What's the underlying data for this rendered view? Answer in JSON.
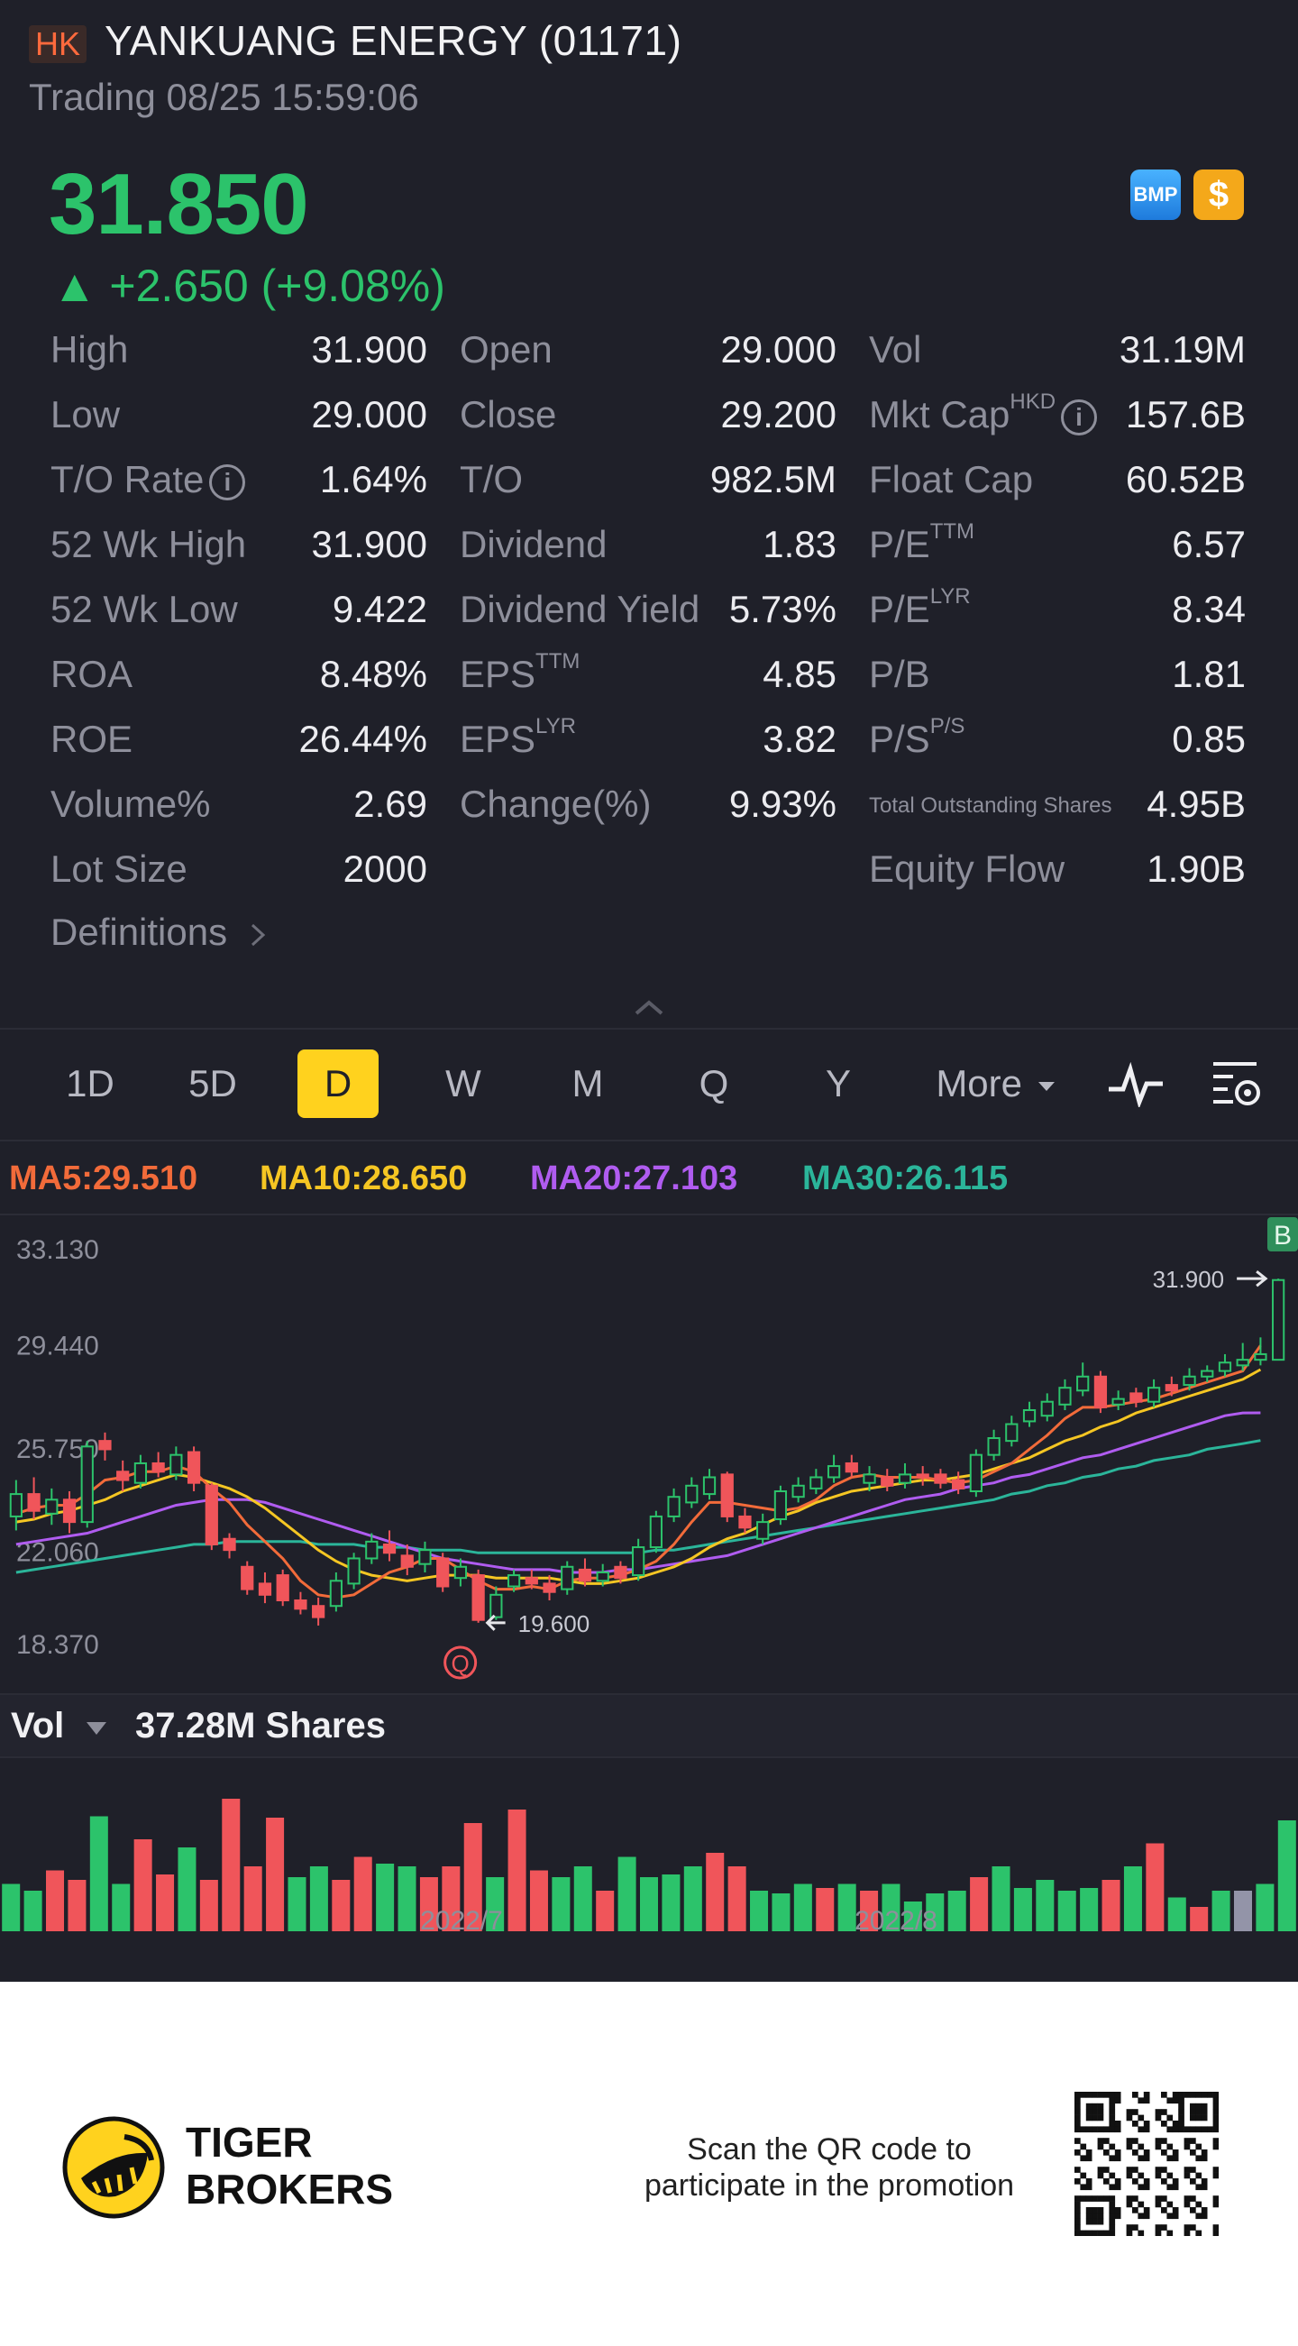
{
  "header": {
    "market": "HK",
    "title": "YANKUANG ENERGY (01171)",
    "status": "Trading 08/25 15:59:06"
  },
  "quote": {
    "price": "31.850",
    "change": "▲ +2.650 (+9.08%)",
    "bmp_label": "BMP",
    "dollar_label": "$",
    "up_color": "#2cc36b"
  },
  "stats": [
    [
      {
        "label": "High",
        "value": "31.900"
      },
      {
        "label": "Open",
        "value": "29.000"
      },
      {
        "label": "Vol",
        "value": "31.19M"
      }
    ],
    [
      {
        "label": "Low",
        "value": "29.000"
      },
      {
        "label": "Close",
        "value": "29.200"
      },
      {
        "label": "Mkt Cap",
        "sup": "HKD",
        "info": true,
        "value": "157.6B"
      }
    ],
    [
      {
        "label": "T/O Rate",
        "info": true,
        "value": "1.64%"
      },
      {
        "label": "T/O",
        "value": "982.5M"
      },
      {
        "label": "Float Cap",
        "value": "60.52B"
      }
    ],
    [
      {
        "label": "52 Wk High",
        "value": "31.900"
      },
      {
        "label": "Dividend",
        "value": "1.83"
      },
      {
        "label": "P/E",
        "sup": "TTM",
        "value": "6.57"
      }
    ],
    [
      {
        "label": "52 Wk Low",
        "value": "9.422"
      },
      {
        "label": "Dividend Yield",
        "value": "5.73%"
      },
      {
        "label": "P/E",
        "sup": "LYR",
        "value": "8.34"
      }
    ],
    [
      {
        "label": "ROA",
        "value": "8.48%"
      },
      {
        "label": "EPS",
        "sup": "TTM",
        "value": "4.85"
      },
      {
        "label": "P/B",
        "value": "1.81"
      }
    ],
    [
      {
        "label": "ROE",
        "value": "26.44%"
      },
      {
        "label": "EPS",
        "sup": "LYR",
        "value": "3.82"
      },
      {
        "label": "P/S",
        "sup": "P/S",
        "value": "0.85"
      }
    ],
    [
      {
        "label": "Volume%",
        "value": "2.69"
      },
      {
        "label": "Change(%)",
        "value": "9.93%"
      },
      {
        "label": "Total Outstanding Shares",
        "small": true,
        "value": "4.95B"
      }
    ],
    [
      {
        "label": "Lot Size",
        "value": "2000"
      },
      {
        "label": "",
        "value": ""
      },
      {
        "label": "Equity Flow",
        "value": "1.90B"
      }
    ]
  ],
  "definitions_label": "Definitions",
  "tabs": [
    "1D",
    "5D",
    "D",
    "W",
    "M",
    "Q",
    "Y",
    "More"
  ],
  "active_tab": "D",
  "ma": {
    "ma5": "MA5:29.510",
    "ma5_color": "#f26b3a",
    "ma10": "MA10:28.650",
    "ma10_color": "#f5c623",
    "ma20": "MA20:27.103",
    "ma20_color": "#b05cf0",
    "ma30": "MA30:26.115",
    "ma30_color": "#2bb59a"
  },
  "chart_data": {
    "type": "candlestick",
    "y_ticks": [
      "33.130",
      "29.440",
      "25.750",
      "22.060",
      "18.370"
    ],
    "ylim": [
      18.37,
      33.13
    ],
    "high_marker": "31.900",
    "low_marker": "19.600",
    "x_labels": [
      "2022/7",
      "2022/8"
    ],
    "event_marker": "Q",
    "buy_marker": "B",
    "candles": [
      {
        "o": 23.4,
        "c": 24.2,
        "h": 24.7,
        "l": 22.9
      },
      {
        "o": 24.2,
        "c": 23.6,
        "h": 24.8,
        "l": 23.3
      },
      {
        "o": 23.5,
        "c": 24.0,
        "h": 24.4,
        "l": 23.1
      },
      {
        "o": 24.0,
        "c": 23.2,
        "h": 24.3,
        "l": 22.8
      },
      {
        "o": 23.2,
        "c": 25.9,
        "h": 26.1,
        "l": 23.0
      },
      {
        "o": 26.1,
        "c": 25.8,
        "h": 26.4,
        "l": 25.4
      },
      {
        "o": 25.0,
        "c": 24.7,
        "h": 25.4,
        "l": 24.3
      },
      {
        "o": 24.6,
        "c": 25.3,
        "h": 25.6,
        "l": 24.4
      },
      {
        "o": 25.3,
        "c": 25.0,
        "h": 25.7,
        "l": 24.8
      },
      {
        "o": 24.9,
        "c": 25.6,
        "h": 25.9,
        "l": 24.7
      },
      {
        "o": 25.7,
        "c": 24.6,
        "h": 25.9,
        "l": 24.3
      },
      {
        "o": 24.5,
        "c": 22.4,
        "h": 24.6,
        "l": 22.2
      },
      {
        "o": 22.6,
        "c": 22.2,
        "h": 22.8,
        "l": 21.9
      },
      {
        "o": 21.6,
        "c": 20.8,
        "h": 21.8,
        "l": 20.6
      },
      {
        "o": 21.0,
        "c": 20.6,
        "h": 21.4,
        "l": 20.3
      },
      {
        "o": 21.3,
        "c": 20.4,
        "h": 21.5,
        "l": 20.2
      },
      {
        "o": 20.4,
        "c": 20.1,
        "h": 20.7,
        "l": 19.9
      },
      {
        "o": 20.2,
        "c": 19.8,
        "h": 20.5,
        "l": 19.5
      },
      {
        "o": 20.2,
        "c": 21.1,
        "h": 21.4,
        "l": 20.0
      },
      {
        "o": 21.0,
        "c": 21.9,
        "h": 22.1,
        "l": 20.8
      },
      {
        "o": 21.9,
        "c": 22.5,
        "h": 22.8,
        "l": 21.7
      },
      {
        "o": 22.4,
        "c": 22.1,
        "h": 22.9,
        "l": 21.8
      },
      {
        "o": 22.0,
        "c": 21.6,
        "h": 22.4,
        "l": 21.3
      },
      {
        "o": 21.7,
        "c": 22.2,
        "h": 22.5,
        "l": 21.4
      },
      {
        "o": 21.9,
        "c": 20.9,
        "h": 22.1,
        "l": 20.7
      },
      {
        "o": 21.2,
        "c": 21.6,
        "h": 21.9,
        "l": 20.9
      },
      {
        "o": 21.3,
        "c": 19.7,
        "h": 21.5,
        "l": 19.6
      },
      {
        "o": 19.8,
        "c": 20.6,
        "h": 20.9,
        "l": 19.7
      },
      {
        "o": 20.9,
        "c": 21.3,
        "h": 21.5,
        "l": 20.7
      },
      {
        "o": 21.2,
        "c": 21.0,
        "h": 21.5,
        "l": 20.8
      },
      {
        "o": 21.0,
        "c": 20.7,
        "h": 21.3,
        "l": 20.4
      },
      {
        "o": 20.8,
        "c": 21.6,
        "h": 21.8,
        "l": 20.6
      },
      {
        "o": 21.5,
        "c": 21.1,
        "h": 21.9,
        "l": 20.9
      },
      {
        "o": 21.1,
        "c": 21.4,
        "h": 21.7,
        "l": 20.9
      },
      {
        "o": 21.6,
        "c": 21.2,
        "h": 21.8,
        "l": 21.0
      },
      {
        "o": 21.3,
        "c": 22.3,
        "h": 22.6,
        "l": 21.1
      },
      {
        "o": 22.3,
        "c": 23.4,
        "h": 23.6,
        "l": 22.1
      },
      {
        "o": 23.4,
        "c": 24.1,
        "h": 24.4,
        "l": 23.2
      },
      {
        "o": 23.9,
        "c": 24.5,
        "h": 24.8,
        "l": 23.7
      },
      {
        "o": 24.2,
        "c": 24.8,
        "h": 25.1,
        "l": 24.0
      },
      {
        "o": 24.9,
        "c": 23.4,
        "h": 25.0,
        "l": 23.2
      },
      {
        "o": 23.4,
        "c": 23.0,
        "h": 23.7,
        "l": 22.8
      },
      {
        "o": 22.6,
        "c": 23.2,
        "h": 23.5,
        "l": 22.4
      },
      {
        "o": 23.3,
        "c": 24.3,
        "h": 24.5,
        "l": 23.1
      },
      {
        "o": 24.1,
        "c": 24.5,
        "h": 24.8,
        "l": 23.9
      },
      {
        "o": 24.4,
        "c": 24.8,
        "h": 25.1,
        "l": 24.2
      },
      {
        "o": 24.8,
        "c": 25.2,
        "h": 25.6,
        "l": 24.6
      },
      {
        "o": 25.3,
        "c": 25.0,
        "h": 25.6,
        "l": 24.8
      },
      {
        "o": 24.6,
        "c": 24.9,
        "h": 25.2,
        "l": 24.3
      },
      {
        "o": 24.8,
        "c": 24.5,
        "h": 25.1,
        "l": 24.3
      },
      {
        "o": 24.6,
        "c": 24.9,
        "h": 25.3,
        "l": 24.4
      },
      {
        "o": 24.9,
        "c": 24.8,
        "h": 25.2,
        "l": 24.5
      },
      {
        "o": 24.9,
        "c": 24.6,
        "h": 25.1,
        "l": 24.4
      },
      {
        "o": 24.7,
        "c": 24.4,
        "h": 25.0,
        "l": 24.2
      },
      {
        "o": 24.3,
        "c": 25.6,
        "h": 25.8,
        "l": 24.1
      },
      {
        "o": 25.6,
        "c": 26.2,
        "h": 26.5,
        "l": 25.4
      },
      {
        "o": 26.1,
        "c": 26.7,
        "h": 27.0,
        "l": 25.9
      },
      {
        "o": 26.8,
        "c": 27.2,
        "h": 27.5,
        "l": 26.6
      },
      {
        "o": 27.0,
        "c": 27.5,
        "h": 27.8,
        "l": 26.8
      },
      {
        "o": 27.4,
        "c": 28.0,
        "h": 28.3,
        "l": 27.2
      },
      {
        "o": 27.9,
        "c": 28.4,
        "h": 28.9,
        "l": 27.7
      },
      {
        "o": 28.4,
        "c": 27.3,
        "h": 28.6,
        "l": 27.1
      },
      {
        "o": 27.4,
        "c": 27.6,
        "h": 27.9,
        "l": 27.2
      },
      {
        "o": 27.8,
        "c": 27.5,
        "h": 28.0,
        "l": 27.3
      },
      {
        "o": 27.5,
        "c": 28.0,
        "h": 28.3,
        "l": 27.3
      },
      {
        "o": 28.1,
        "c": 27.9,
        "h": 28.4,
        "l": 27.7
      },
      {
        "o": 28.1,
        "c": 28.4,
        "h": 28.7,
        "l": 27.9
      },
      {
        "o": 28.4,
        "c": 28.6,
        "h": 28.8,
        "l": 28.2
      },
      {
        "o": 28.6,
        "c": 28.9,
        "h": 29.2,
        "l": 28.4
      },
      {
        "o": 28.8,
        "c": 29.0,
        "h": 29.6,
        "l": 28.6
      },
      {
        "o": 29.0,
        "c": 29.2,
        "h": 29.8,
        "l": 28.8
      },
      {
        "o": 29.0,
        "c": 31.85,
        "h": 31.9,
        "l": 29.0
      }
    ],
    "ma5": [
      23.5,
      23.7,
      23.8,
      23.8,
      24.2,
      24.7,
      24.8,
      25.0,
      25.0,
      25.2,
      25.0,
      24.4,
      23.9,
      23.1,
      22.5,
      21.9,
      21.1,
      20.6,
      20.5,
      20.6,
      21.0,
      21.4,
      21.6,
      21.9,
      21.9,
      21.5,
      21.1,
      20.8,
      20.8,
      20.9,
      20.8,
      21.1,
      21.2,
      21.2,
      21.3,
      21.5,
      21.8,
      22.4,
      23.2,
      23.9,
      23.9,
      23.8,
      23.7,
      23.6,
      23.7,
      24.0,
      24.5,
      24.8,
      24.9,
      24.8,
      24.8,
      24.8,
      24.7,
      24.6,
      24.7,
      25.0,
      25.3,
      25.8,
      26.3,
      26.9,
      27.3,
      27.3,
      27.4,
      27.5,
      27.6,
      27.8,
      28.0,
      28.2,
      28.4,
      28.6,
      29.51
    ],
    "ma10": [
      23.2,
      23.3,
      23.5,
      23.6,
      23.8,
      24.0,
      24.3,
      24.5,
      24.7,
      24.9,
      24.8,
      24.6,
      24.4,
      24.1,
      23.7,
      23.2,
      22.7,
      22.2,
      21.8,
      21.5,
      21.3,
      21.2,
      21.1,
      21.2,
      21.3,
      21.3,
      21.3,
      21.2,
      21.2,
      21.2,
      21.2,
      21.1,
      21.0,
      21.0,
      21.1,
      21.2,
      21.4,
      21.6,
      21.9,
      22.3,
      22.6,
      22.8,
      23.1,
      23.4,
      23.6,
      23.9,
      24.1,
      24.3,
      24.4,
      24.5,
      24.6,
      24.7,
      24.7,
      24.8,
      24.9,
      25.1,
      25.3,
      25.5,
      25.8,
      26.1,
      26.3,
      26.6,
      26.8,
      27.1,
      27.3,
      27.5,
      27.7,
      27.9,
      28.1,
      28.3,
      28.65
    ],
    "ma20": [
      22.4,
      22.5,
      22.6,
      22.7,
      22.8,
      23.0,
      23.2,
      23.4,
      23.6,
      23.8,
      23.9,
      24.0,
      24.0,
      24.0,
      23.9,
      23.7,
      23.5,
      23.3,
      23.1,
      22.9,
      22.7,
      22.5,
      22.3,
      22.1,
      21.9,
      21.8,
      21.7,
      21.6,
      21.5,
      21.5,
      21.5,
      21.4,
      21.4,
      21.4,
      21.5,
      21.5,
      21.6,
      21.7,
      21.8,
      21.9,
      22.0,
      22.2,
      22.4,
      22.6,
      22.8,
      23.0,
      23.2,
      23.4,
      23.6,
      23.8,
      24.0,
      24.1,
      24.2,
      24.4,
      24.5,
      24.6,
      24.8,
      24.9,
      25.1,
      25.3,
      25.5,
      25.6,
      25.8,
      26.0,
      26.2,
      26.4,
      26.6,
      26.8,
      27.0,
      27.1,
      27.103
    ],
    "ma30": [
      21.4,
      21.5,
      21.6,
      21.7,
      21.8,
      21.9,
      22.0,
      22.1,
      22.2,
      22.3,
      22.4,
      22.4,
      22.5,
      22.5,
      22.5,
      22.5,
      22.5,
      22.4,
      22.4,
      22.4,
      22.3,
      22.3,
      22.3,
      22.2,
      22.2,
      22.2,
      22.1,
      22.1,
      22.1,
      22.1,
      22.1,
      22.1,
      22.1,
      22.1,
      22.1,
      22.1,
      22.2,
      22.2,
      22.3,
      22.4,
      22.5,
      22.6,
      22.7,
      22.8,
      22.9,
      23.0,
      23.1,
      23.2,
      23.3,
      23.4,
      23.5,
      23.6,
      23.7,
      23.8,
      23.9,
      24.0,
      24.2,
      24.3,
      24.5,
      24.6,
      24.8,
      24.9,
      25.1,
      25.2,
      25.4,
      25.5,
      25.6,
      25.8,
      25.9,
      26.0,
      26.115
    ]
  },
  "volume": {
    "label": "Vol",
    "value": "37.28M Shares",
    "bars": [
      {
        "v": 0.35,
        "d": "up"
      },
      {
        "v": 0.3,
        "d": "up"
      },
      {
        "v": 0.45,
        "d": "down"
      },
      {
        "v": 0.38,
        "d": "down"
      },
      {
        "v": 0.85,
        "d": "up"
      },
      {
        "v": 0.35,
        "d": "up"
      },
      {
        "v": 0.68,
        "d": "down"
      },
      {
        "v": 0.42,
        "d": "down"
      },
      {
        "v": 0.62,
        "d": "up"
      },
      {
        "v": 0.38,
        "d": "down"
      },
      {
        "v": 0.98,
        "d": "down"
      },
      {
        "v": 0.48,
        "d": "down"
      },
      {
        "v": 0.84,
        "d": "down"
      },
      {
        "v": 0.4,
        "d": "up"
      },
      {
        "v": 0.48,
        "d": "up"
      },
      {
        "v": 0.38,
        "d": "down"
      },
      {
        "v": 0.55,
        "d": "down"
      },
      {
        "v": 0.5,
        "d": "up"
      },
      {
        "v": 0.48,
        "d": "up"
      },
      {
        "v": 0.4,
        "d": "down"
      },
      {
        "v": 0.48,
        "d": "down"
      },
      {
        "v": 0.8,
        "d": "down"
      },
      {
        "v": 0.4,
        "d": "up"
      },
      {
        "v": 0.9,
        "d": "down"
      },
      {
        "v": 0.45,
        "d": "down"
      },
      {
        "v": 0.4,
        "d": "up"
      },
      {
        "v": 0.48,
        "d": "up"
      },
      {
        "v": 0.3,
        "d": "down"
      },
      {
        "v": 0.55,
        "d": "up"
      },
      {
        "v": 0.4,
        "d": "up"
      },
      {
        "v": 0.42,
        "d": "up"
      },
      {
        "v": 0.48,
        "d": "up"
      },
      {
        "v": 0.58,
        "d": "down"
      },
      {
        "v": 0.48,
        "d": "down"
      },
      {
        "v": 0.3,
        "d": "up"
      },
      {
        "v": 0.28,
        "d": "up"
      },
      {
        "v": 0.35,
        "d": "up"
      },
      {
        "v": 0.32,
        "d": "down"
      },
      {
        "v": 0.35,
        "d": "up"
      },
      {
        "v": 0.3,
        "d": "down"
      },
      {
        "v": 0.35,
        "d": "up"
      },
      {
        "v": 0.22,
        "d": "up"
      },
      {
        "v": 0.28,
        "d": "up"
      },
      {
        "v": 0.3,
        "d": "up"
      },
      {
        "v": 0.4,
        "d": "down"
      },
      {
        "v": 0.48,
        "d": "up"
      },
      {
        "v": 0.32,
        "d": "up"
      },
      {
        "v": 0.38,
        "d": "up"
      },
      {
        "v": 0.3,
        "d": "up"
      },
      {
        "v": 0.32,
        "d": "up"
      },
      {
        "v": 0.38,
        "d": "down"
      },
      {
        "v": 0.48,
        "d": "up"
      },
      {
        "v": 0.65,
        "d": "down"
      },
      {
        "v": 0.25,
        "d": "up"
      },
      {
        "v": 0.18,
        "d": "down"
      },
      {
        "v": 0.3,
        "d": "up"
      },
      {
        "v": 0.3,
        "d": "neutral"
      },
      {
        "v": 0.35,
        "d": "up"
      },
      {
        "v": 0.82,
        "d": "up"
      }
    ]
  },
  "footer": {
    "brand_line1": "TIGER",
    "brand_line2": "BROKERS",
    "promo": "Scan the QR code to participate in the promotion"
  }
}
